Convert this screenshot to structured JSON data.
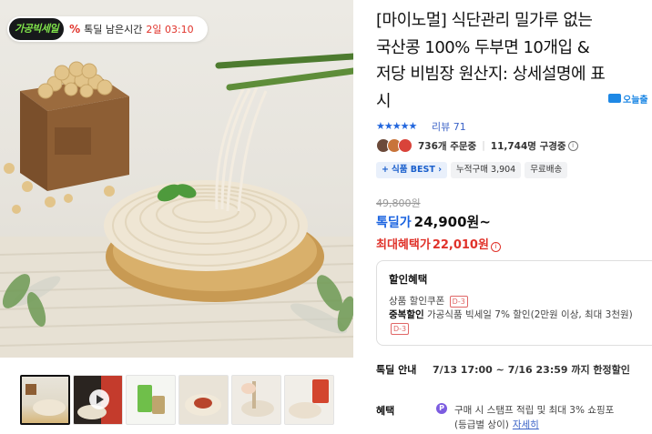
{
  "promo_badge": {
    "logo": "가공빅세일",
    "percent_icon": "%",
    "text": "톡딜 남은시간",
    "time": "2일 03:10"
  },
  "hero_image": {
    "alt": "두부면 비빔면 제품 이미지"
  },
  "thumbnails": [
    {
      "name": "thumb-1",
      "selected": true
    },
    {
      "name": "thumb-2-video",
      "selected": false
    },
    {
      "name": "thumb-3",
      "selected": false
    },
    {
      "name": "thumb-4",
      "selected": false
    },
    {
      "name": "thumb-5",
      "selected": false
    },
    {
      "name": "thumb-6",
      "selected": false
    }
  ],
  "product": {
    "title": "[마이노멀] 식단관리 밀가루 없는 국산콩 100% 두부면 10개입 & 저당 비빔장 원산지: 상세설명에 표시",
    "rocket_badge": "오늘출",
    "stars": "★★★★★",
    "review_link": "리뷰 71",
    "orders": "736개 주문중",
    "subscribers": "11,744명 구경중",
    "tags": [
      "식품 BEST",
      "누적구매 3,904",
      "무료배송"
    ],
    "original_price": "49,800원",
    "sale_label": "톡딜가",
    "sale_price": "24,900원~",
    "max_label": "최대혜택가",
    "max_price": "22,010원",
    "info_icon": "i"
  },
  "benefit_box": {
    "title": "할인혜택",
    "coupon_label": "상품 할인쿠폰",
    "coupon_tag": "D-3",
    "dup_bold": "중복할인",
    "dup_text": "가공식품 빅세일 7% 할인(2만원 이상, 최대 3천원)",
    "dup_tag": "D-3"
  },
  "deal": {
    "label": "톡딜 안내",
    "time": "7/13 17:00 ~ 7/16 23:59 까지 한정할인"
  },
  "benefit": {
    "label": "혜택",
    "p_icon": "P",
    "line1": "구매 시 스탬프 적립 및 최대 3% 쇼핑포",
    "line2": "(등급별 상이)",
    "detail_link": "자세히"
  },
  "colors": {
    "accent_blue": "#1a63e0",
    "sale_red": "#e0322a",
    "logo_green": "#7fe24a",
    "star_blue": "#2266dd"
  }
}
